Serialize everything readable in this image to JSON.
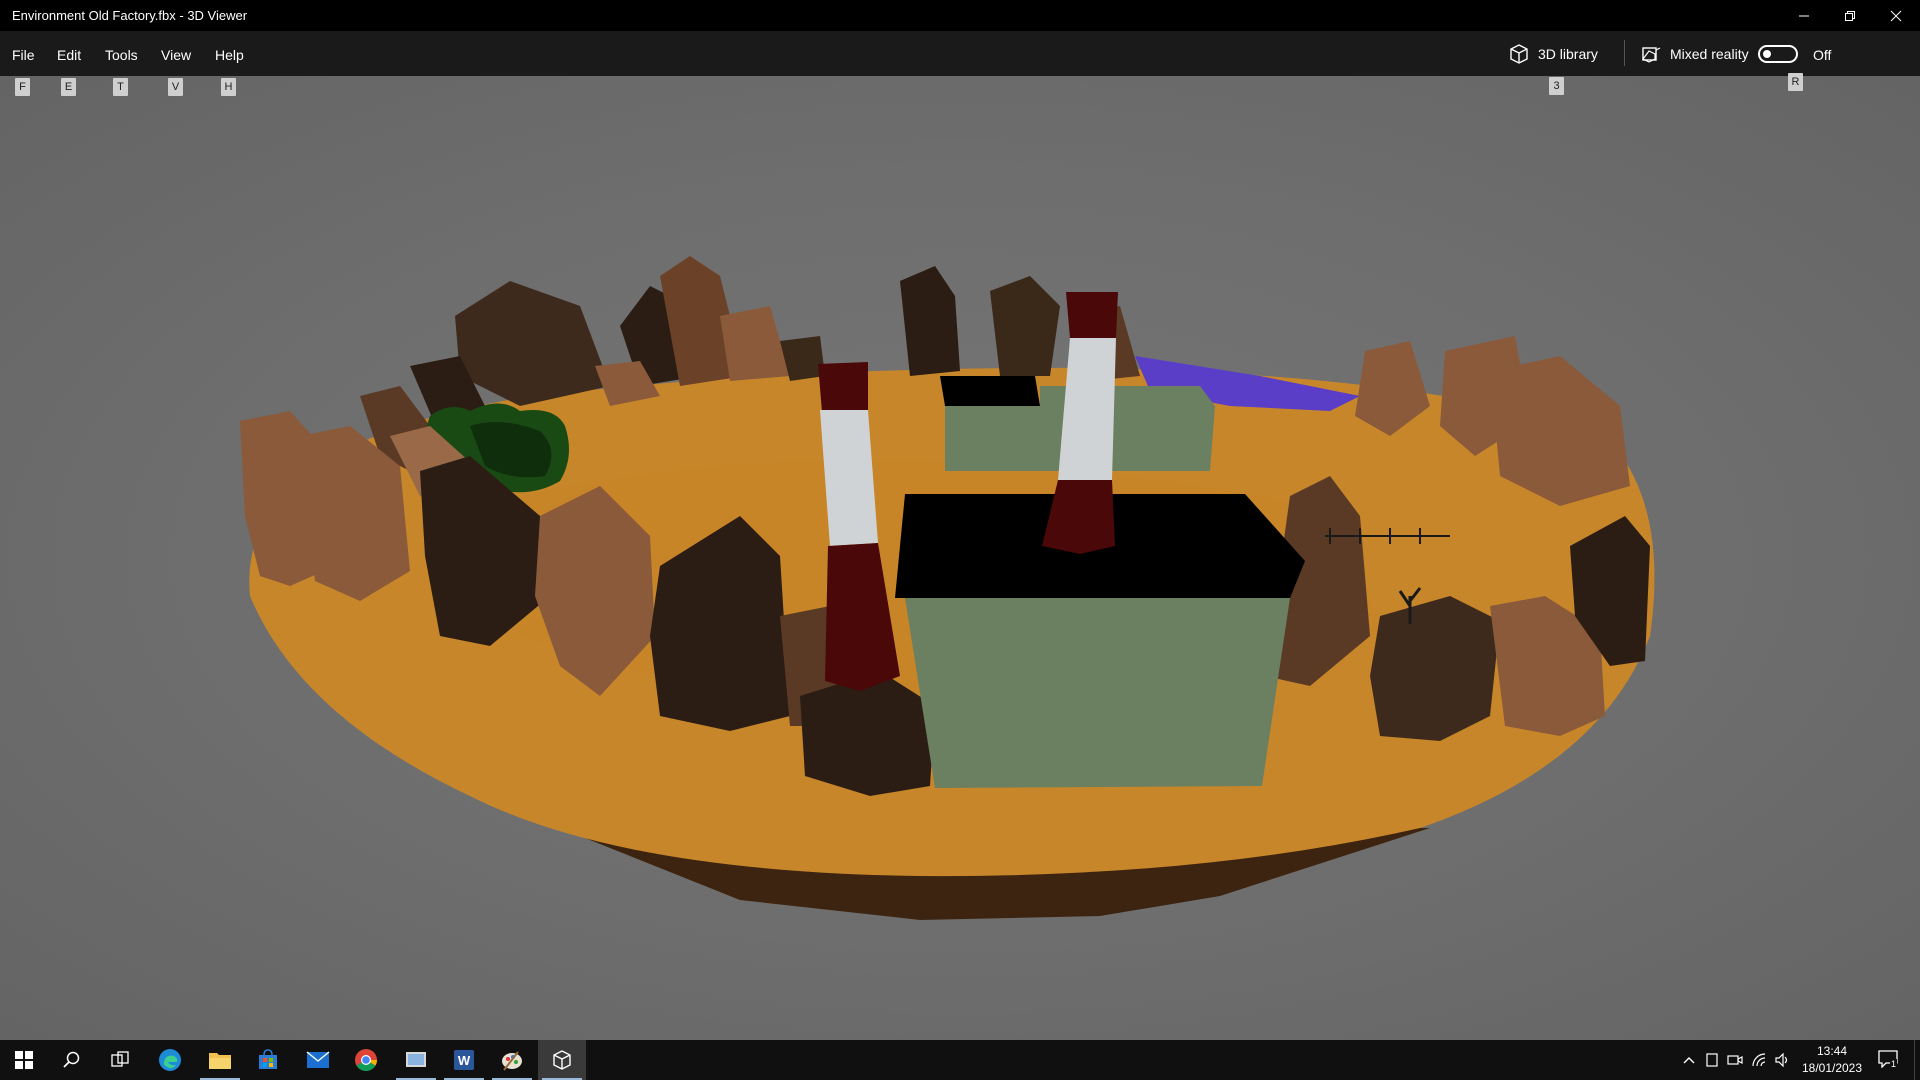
{
  "window": {
    "title": "Environment Old Factory.fbx - 3D Viewer"
  },
  "menu": {
    "items": [
      {
        "label": "File",
        "keytip": "F"
      },
      {
        "label": "Edit",
        "keytip": "E"
      },
      {
        "label": "Tools",
        "keytip": "T"
      },
      {
        "label": "View",
        "keytip": "V"
      },
      {
        "label": "Help",
        "keytip": "H"
      }
    ],
    "library_label": "3D library",
    "library_keytip": "3",
    "mixed_reality_label": "Mixed reality",
    "mixed_reality_state": "Off",
    "mixed_reality_keytip": "R"
  },
  "taskbar": {
    "apps": [
      "start-icon",
      "search-icon",
      "task-view-icon",
      "edge-icon",
      "file-explorer-icon",
      "store-icon",
      "mail-icon",
      "chrome-icon",
      "snipping-tool-icon",
      "word-icon",
      "paint-icon",
      "3d-viewer-icon"
    ],
    "time": "13:44",
    "date": "18/01/2023",
    "notification_count": "1"
  },
  "colors": {
    "ground": "#c8862a",
    "rock_dark": "#2e1f14",
    "rock_light": "#8a5a3a",
    "building": "#6b8060",
    "roof": "#000000",
    "chimney_white": "#cfd3d6",
    "chimney_red": "#4a0808",
    "water": "#5a3ec8"
  }
}
